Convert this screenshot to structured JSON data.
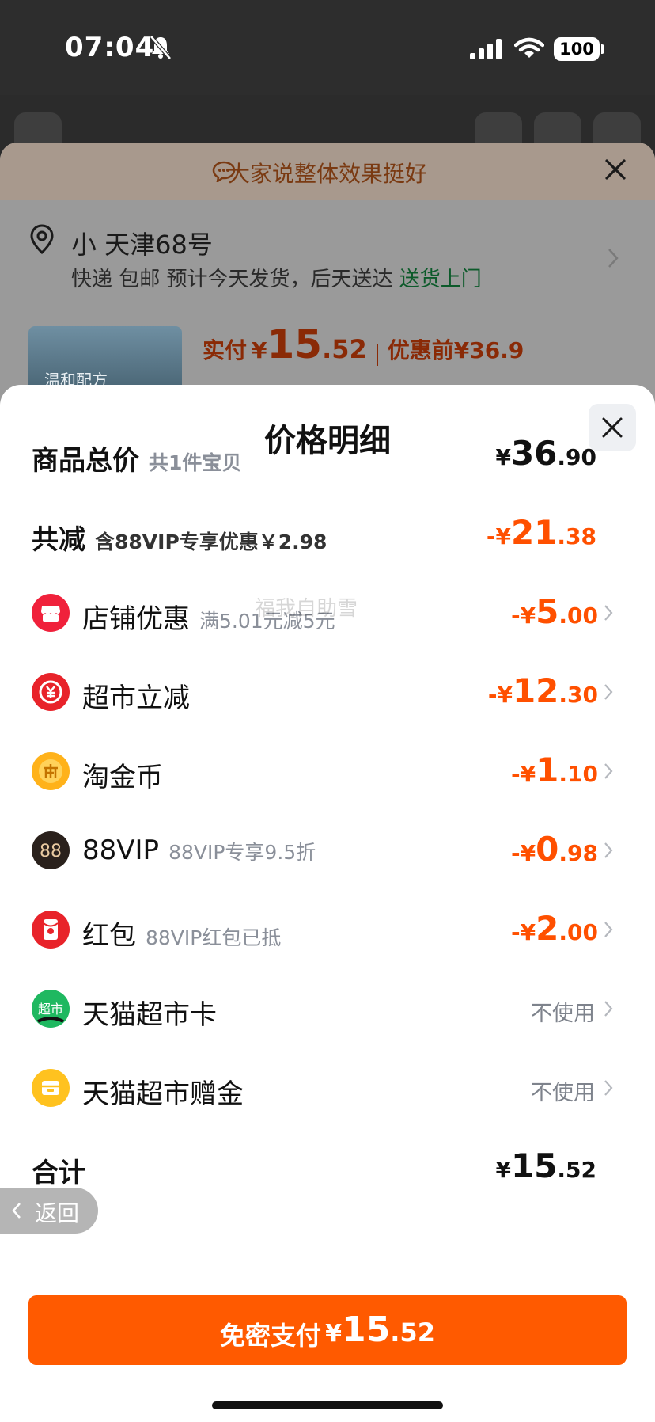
{
  "status_bar": {
    "time": "07:04",
    "battery": "100"
  },
  "order": {
    "banner": "大家说整体效果挺好",
    "address": "小 天津68号",
    "shipping_text": "快递 包邮 预计今天发货，后天送达",
    "delivery_tag": "送货上门",
    "product_thumb_text": "温和配方",
    "paid_label": "实付",
    "paid_currency": "¥",
    "paid_integer": "15",
    "paid_decimal": ".52",
    "before_discount": "优惠前¥36.9"
  },
  "modal": {
    "title": "价格明细",
    "total": {
      "label": "商品总价",
      "sub": "共1件宝贝",
      "currency": "¥",
      "integer": "36",
      "decimal": ".90"
    },
    "reduction": {
      "label": "共减",
      "sub": "含88VIP专享优惠￥2.98",
      "currency": "-¥",
      "integer": "21",
      "decimal": ".38"
    },
    "items": [
      {
        "icon": "store-icon",
        "label": "店铺优惠",
        "sub": "满5.01元减5元",
        "currency": "-¥",
        "integer": "5",
        "decimal": ".00"
      },
      {
        "icon": "supermarket-discount-icon",
        "label": "超市立减",
        "sub": "",
        "currency": "-¥",
        "integer": "12",
        "decimal": ".30"
      },
      {
        "icon": "taojin-coin-icon",
        "label": "淘金币",
        "sub": "",
        "currency": "-¥",
        "integer": "1",
        "decimal": ".10"
      },
      {
        "icon": "88vip-icon",
        "icon_text": "88",
        "label": "88VIP",
        "sub": "88VIP专享9.5折",
        "currency": "-¥",
        "integer": "0",
        "decimal": ".98"
      },
      {
        "icon": "red-packet-icon",
        "label": "红包",
        "sub": "88VIP红包已抵",
        "currency": "-¥",
        "integer": "2",
        "decimal": ".00"
      },
      {
        "icon": "tmall-supermarket-card-icon",
        "icon_text": "超市",
        "label": "天猫超市卡",
        "status": "不使用"
      },
      {
        "icon": "tmall-gift-money-icon",
        "label": "天猫超市赠金",
        "status": "不使用"
      }
    ],
    "watermark": "福我自助雪",
    "sum": {
      "label": "合计",
      "currency": "¥",
      "integer": "15",
      "decimal": ".52"
    },
    "back_label": "返回",
    "pay_button": {
      "label": "免密支付",
      "currency": "¥",
      "integer": "15",
      "decimal": ".52"
    }
  },
  "colors": {
    "accent": "#ff5000",
    "pay_button": "#ff5a00",
    "muted": "#8a8f99"
  }
}
